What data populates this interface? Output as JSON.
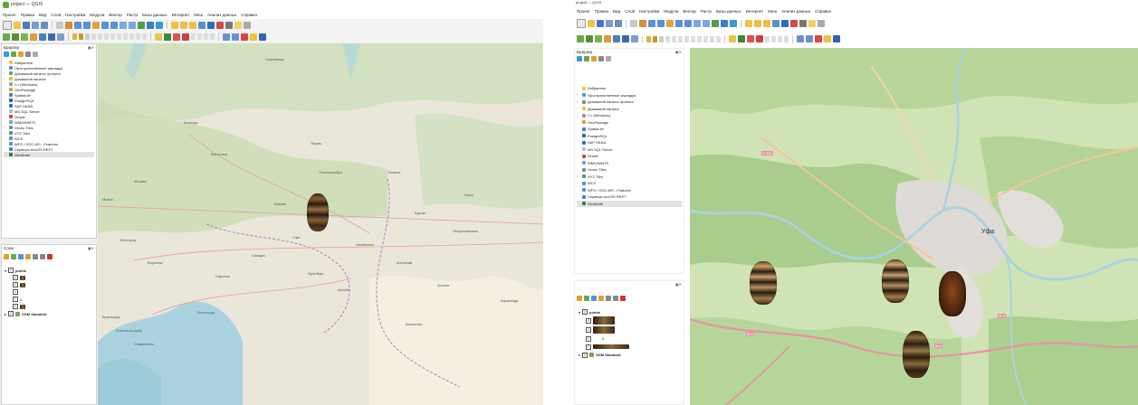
{
  "left": {
    "window_title": "project — QGIS",
    "menu": [
      "Проект",
      "Правка",
      "Вид",
      "Слой",
      "Настройки",
      "Модули",
      "Вектор",
      "Растр",
      "Базы данных",
      "Интернет",
      "Меш",
      "Анализ данных",
      "Справка"
    ],
    "browser_panel": {
      "title": "Браузер",
      "items": [
        "Избранное",
        "Пространственные закладки",
        "Домашний каталог проекта",
        "Домашний каталог",
        "C:\\ (Windows)",
        "GeoPackage",
        "SpatiaLite",
        "PostgreSQL",
        "SAP HANA",
        "MS SQL Server",
        "Oracle",
        "WMS/WMTS",
        "Vector Tiles",
        "XYZ Tiles",
        "WCS",
        "WFS / OGC API - Features",
        "Серверы ArcGIS REST",
        "GeoNode"
      ]
    },
    "layers_panel": {
      "title": "Слои",
      "group_name": "points",
      "values": [
        "0"
      ],
      "base_layer": "OSM Standard"
    },
    "map_labels": [
      "Пермь",
      "Сыктывкар",
      "Екатеринбург",
      "Тюмень",
      "Курган",
      "Омск",
      "Вологда",
      "Кострома",
      "Челябинск",
      "Уфа",
      "Оренбург",
      "Актобе",
      "Астана",
      "Казахстан",
      "Самара",
      "Саратов",
      "Воронеж",
      "Волгоград",
      "Ростов-на-Дону",
      "Краснодар",
      "Ставрополь",
      "Москва",
      "Белгород",
      "Минск",
      "Казань",
      "Караганда",
      "Костанай",
      "Петропавловск"
    ]
  },
  "right": {
    "window_title": "project — QGIS",
    "menu": [
      "Проект",
      "Правка",
      "Вид",
      "Слой",
      "Настройки",
      "Модули",
      "Вектор",
      "Растр",
      "Базы данных",
      "Интернет",
      "Меш",
      "Анализ данных",
      "Справка"
    ],
    "browser_panel": {
      "title": "Браузер",
      "items": [
        "Избранное",
        "Пространственные закладки",
        "Домашний каталог проекта",
        "Домашний каталог",
        "C:\\ (Windows)",
        "GeoPackage",
        "SpatiaLite",
        "PostgreSQL",
        "SAP HANA",
        "MS SQL Server",
        "Oracle",
        "WMS/WMTS",
        "Vector Tiles",
        "XYZ Tiles",
        "WCS",
        "WFS / OGC API - Features",
        "Серверы ArcGIS REST",
        "GeoNode"
      ]
    },
    "layers_panel": {
      "group_name": "points",
      "values": [
        "0"
      ],
      "base_layer": "OSM Standard"
    },
    "map_labels": [
      "Уфа",
      "Р-240",
      "М-5",
      "М-5",
      "М-5"
    ]
  },
  "colors": {
    "qgis_green": "#64a543",
    "map_land": "#f2efe9",
    "map_forest": "#add19e",
    "map_water": "#aad3df",
    "map_urban": "#dddddd"
  }
}
